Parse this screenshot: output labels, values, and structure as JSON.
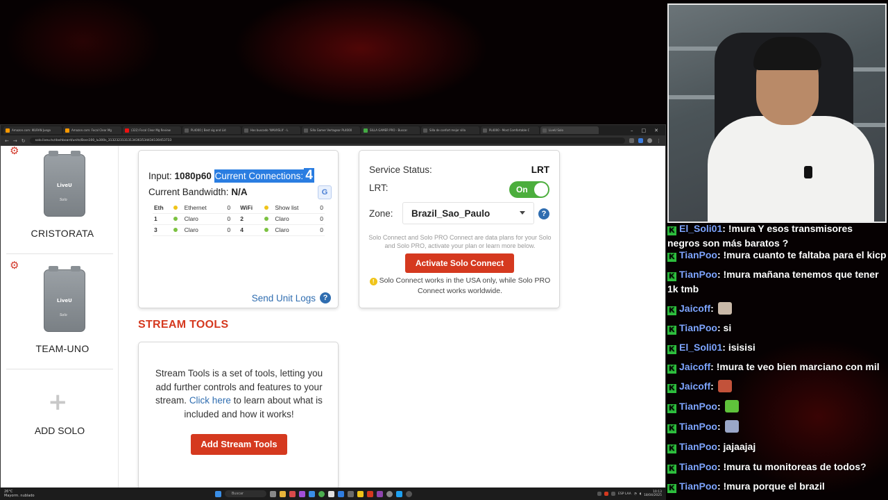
{
  "browser": {
    "tabs": [
      {
        "title": "Amazon.com: IKURAN Juego",
        "color": "#f90"
      },
      {
        "title": "Amazon.com: Focal Clear Mg",
        "color": "#f90"
      },
      {
        "title": "(322) Focal Clear Mg Review",
        "color": "#e11"
      },
      {
        "title": "PL4000 | Best sig and Lid",
        "color": "#555"
      },
      {
        "title": "Has buscado 'WAVXSLX' - L",
        "color": "#555"
      },
      {
        "title": "Silla Gamer Vertagear PL4000",
        "color": "#555"
      },
      {
        "title": "SILLA GAMER PRO - Buscar",
        "color": "#4a4"
      },
      {
        "title": "Silla de confort mejor silla",
        "color": "#555"
      },
      {
        "title": "PL4000 - Most Comfortable C",
        "color": "#555"
      },
      {
        "title": "LiveU Solo",
        "color": "#555",
        "active": true
      }
    ],
    "url": "solo.liveu.tv/dashboard/units/Boss100_lu300s_31323231313134363534434130453733"
  },
  "sidebar": {
    "devices": [
      {
        "name": "CRISTORATA"
      },
      {
        "name": "TEAM-UNO"
      }
    ],
    "unit_logo": "LiveU",
    "unit_sub": "Solo",
    "add_label": "ADD SOLO",
    "add_symbol": "+"
  },
  "unit_card": {
    "input_label": "Input:",
    "input_value": "1080p60",
    "connections_label": "Current Connections:",
    "connections_value": "4",
    "bandwidth_label": "Current Bandwidth:",
    "bandwidth_value": "N/A",
    "table_headers": [
      "Eth",
      "Ethernet",
      "0",
      "WiFi",
      "Show list",
      "0"
    ],
    "rows": [
      {
        "a": "1",
        "a_name": "Claro",
        "a_val": "0",
        "b": "2",
        "b_name": "Claro",
        "b_val": "0"
      },
      {
        "a": "3",
        "a_name": "Claro",
        "a_val": "0",
        "b": "4",
        "b_name": "Claro",
        "b_val": "0"
      }
    ],
    "send_logs": "Send Unit Logs",
    "help_symbol": "?"
  },
  "status_card": {
    "service_label": "Service Status:",
    "service_value": "LRT",
    "lrt_label": "LRT:",
    "toggle_label": "On",
    "zone_label": "Zone:",
    "zone_value": "Brazil_Sao_Paulo",
    "plans_note": "Solo Connect and Solo PRO Connect are data plans for your Solo and Solo PRO, activate your plan or learn more below.",
    "activate_label": "Activate Solo Connect",
    "usa_note": "Solo Connect works in the USA only, while Solo PRO Connect works worldwide.",
    "warn_symbol": "!"
  },
  "stream_tools": {
    "heading": "STREAM TOOLS",
    "desc_before": "Stream Tools is a set of tools, letting you add further controls and features to your stream. ",
    "desc_link": "Click here",
    "desc_after": " to learn about what is included and how it works!",
    "button_label": "Add Stream Tools"
  },
  "taskbar": {
    "weather_temp": "26°C",
    "weather_text": "Mayorm. nublado",
    "search_placeholder": "Buscar",
    "lang": "ESP LAA",
    "time": "10:13",
    "date": "18/04/2025"
  },
  "chat": {
    "messages": [
      {
        "user": "El_Soli01",
        "text": "!mura Y esos transmisores negros son más baratos ?"
      },
      {
        "user": "TianPoo",
        "text": "!mura cuanto te faltaba para el kicp"
      },
      {
        "user": "TianPoo",
        "text": "!mura mañana tenemos que tener 1k tmb"
      },
      {
        "user": "Jaicoff",
        "text": "",
        "emote": "#c9b9a8"
      },
      {
        "user": "TianPoo",
        "text": "si"
      },
      {
        "user": "El_Soli01",
        "text": "isisisi"
      },
      {
        "user": "Jaicoff",
        "text": "!mura te veo bien marciano con mil"
      },
      {
        "user": "Jaicoff",
        "text": "",
        "emote": "#c2523a"
      },
      {
        "user": "TianPoo",
        "text": "",
        "emote": "#5fc23b"
      },
      {
        "user": "TianPoo",
        "text": "",
        "emote": "#9aa7c8"
      },
      {
        "user": "TianPoo",
        "text": "jajaajaj"
      },
      {
        "user": "TianPoo",
        "text": "!mura tu monitoreas de todos?"
      },
      {
        "user": "TianPoo",
        "text": "!mura porque el brazil"
      }
    ]
  },
  "colors": {
    "accent_red": "#d5391f",
    "link_blue": "#2f6db0",
    "toggle_green": "#4cae3d",
    "highlight": "#2a7de1"
  }
}
